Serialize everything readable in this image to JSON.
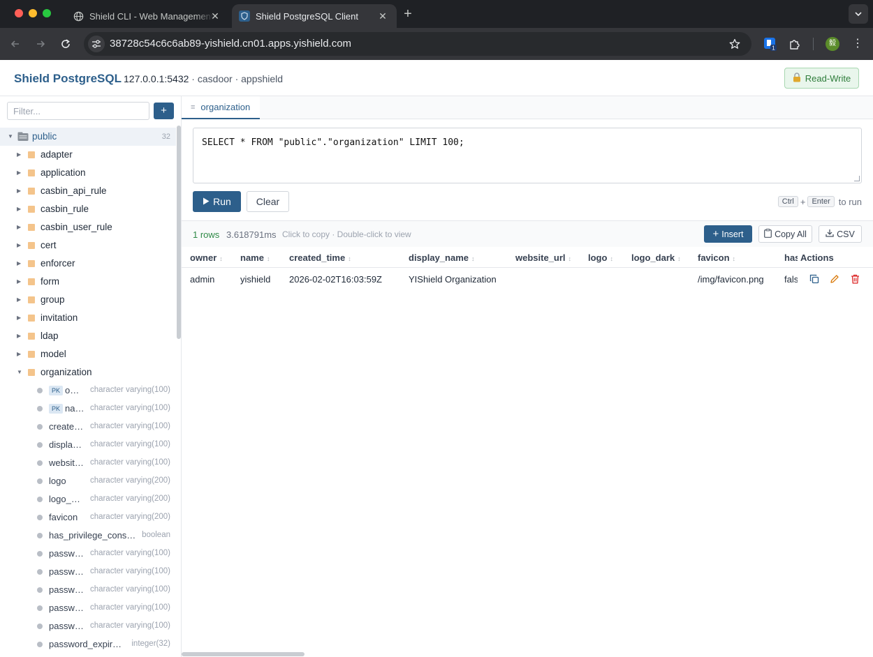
{
  "browser": {
    "tabs": [
      {
        "title": "Shield CLI - Web Management",
        "active": false
      },
      {
        "title": "Shield PostgreSQL Client",
        "active": true
      }
    ],
    "url": "38728c54c6c6ab89-yishield.cn01.apps.yishield.com",
    "profile_initial": "毅",
    "extension_badge": "1"
  },
  "header": {
    "brand": "Shield PostgreSQL",
    "address": "127.0.0.1:5432",
    "separator": " · ",
    "database": "casdoor",
    "user": "appshield",
    "mode_label": "Read-Write"
  },
  "sidebar": {
    "filter_placeholder": "Filter...",
    "add_label": "+",
    "schema": {
      "name": "public",
      "count": "32"
    },
    "tables": [
      "adapter",
      "application",
      "casbin_api_rule",
      "casbin_rule",
      "casbin_user_rule",
      "cert",
      "enforcer",
      "form",
      "group",
      "invitation",
      "ldap",
      "model"
    ],
    "expanded_table": "organization",
    "columns": [
      {
        "name": "owner",
        "pk": true,
        "type": "character varying(100)"
      },
      {
        "name": "name",
        "pk": true,
        "type": "character varying(100)"
      },
      {
        "name": "created_time",
        "pk": false,
        "type": "character varying(100)"
      },
      {
        "name": "display_name",
        "pk": false,
        "type": "character varying(100)"
      },
      {
        "name": "website_url",
        "pk": false,
        "type": "character varying(100)"
      },
      {
        "name": "logo",
        "pk": false,
        "type": "character varying(200)"
      },
      {
        "name": "logo_dark",
        "pk": false,
        "type": "character varying(200)"
      },
      {
        "name": "favicon",
        "pk": false,
        "type": "character varying(200)"
      },
      {
        "name": "has_privilege_consent",
        "pk": false,
        "type": "boolean"
      },
      {
        "name": "password_type",
        "pk": false,
        "type": "character varying(100)"
      },
      {
        "name": "password_salt",
        "pk": false,
        "type": "character varying(100)"
      },
      {
        "name": "password_options",
        "pk": false,
        "type": "character varying(100)"
      },
      {
        "name": "password_obfuscator_type",
        "pk": false,
        "type": "character varying(100)"
      },
      {
        "name": "password_obfuscator_key",
        "pk": false,
        "type": "character varying(100)"
      },
      {
        "name": "password_expire_days",
        "pk": false,
        "type": "integer(32)"
      }
    ],
    "pk_label": "PK"
  },
  "query": {
    "tab_label": "organization",
    "sql": "SELECT * FROM \"public\".\"organization\" LIMIT 100;",
    "run_label": "Run",
    "clear_label": "Clear",
    "hint_key1": "Ctrl",
    "hint_plus": "+",
    "hint_key2": "Enter",
    "hint_suffix": "to run"
  },
  "results": {
    "row_count": "1 rows",
    "exec_time": "3.618791ms",
    "hint": "Click to copy · Double-click to view",
    "insert_label": "Insert",
    "copy_all_label": "Copy All",
    "csv_label": "CSV",
    "columns": [
      "owner",
      "name",
      "created_time",
      "display_name",
      "website_url",
      "logo",
      "logo_dark",
      "favicon",
      "has"
    ],
    "actions_label": "Actions",
    "rows": [
      [
        "admin",
        "yishield",
        "2026-02-02T16:03:59Z",
        "YIShield Organization",
        "",
        "",
        "",
        "/img/favicon.png",
        "false"
      ]
    ]
  },
  "colors": {
    "brand": "#2d5f8b",
    "success": "#2f7d3b",
    "danger": "#dc2626",
    "edit": "#d97706"
  },
  "icons": [
    "globe-icon",
    "shield-tab-icon",
    "back-icon",
    "forward-icon",
    "reload-icon",
    "site-settings-icon",
    "star-icon",
    "extension-icon",
    "puzzle-icon",
    "lock-icon",
    "database-icon",
    "table-icon",
    "copy-icon",
    "edit-icon",
    "delete-icon"
  ]
}
